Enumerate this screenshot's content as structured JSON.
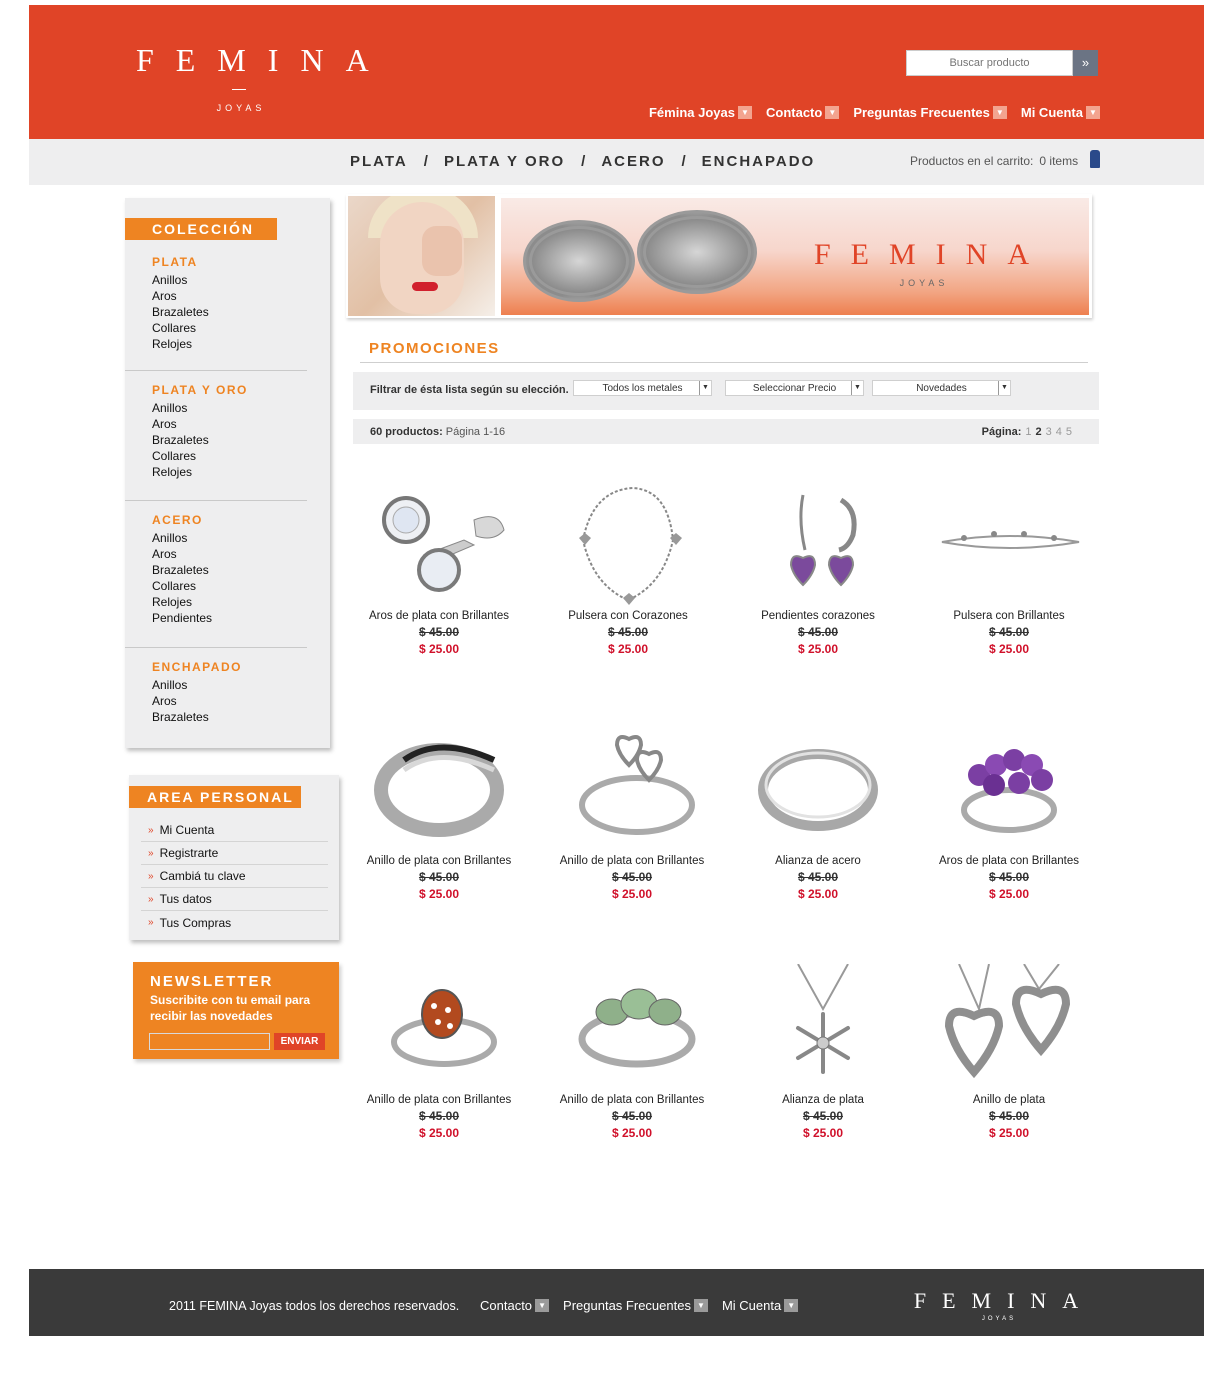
{
  "header": {
    "logo_main": "FEMINA",
    "logo_sub": "JOYAS",
    "search_placeholder": "Buscar producto",
    "search_icon": "»",
    "nav": [
      "Fémina Joyas",
      "Contacto",
      "Preguntas Frecuentes",
      "Mi Cuenta"
    ]
  },
  "catbar": {
    "categories": [
      "PLATA",
      "PLATA Y ORO",
      "ACERO",
      "ENCHAPADO"
    ],
    "separator": "/",
    "cart_label": "Productos  en el carrito:",
    "cart_count": "0 items"
  },
  "sidebar": {
    "coleccion_title": "COLECCIÓN",
    "groups": [
      {
        "title": "PLATA",
        "items": [
          "Anillos",
          "Aros",
          "Brazaletes",
          "Collares",
          "Relojes"
        ]
      },
      {
        "title": "PLATA Y ORO",
        "items": [
          "Anillos",
          "Aros",
          "Brazaletes",
          "Collares",
          "Relojes"
        ]
      },
      {
        "title": "ACERO",
        "items": [
          "Anillos",
          "Aros",
          "Brazaletes",
          "Collares",
          "Relojes",
          "Pendientes"
        ]
      },
      {
        "title": "ENCHAPADO",
        "items": [
          "Anillos",
          "Aros",
          "Brazaletes"
        ]
      }
    ],
    "personal_title": "AREA PERSONAL",
    "personal_items": [
      "Mi Cuenta",
      "Registrarte",
      "Cambiá tu clave",
      "Tus datos",
      "Tus Compras"
    ],
    "newsletter_title": "NEWSLETTER",
    "newsletter_text": "Suscribite con tu email para recibir las novedades",
    "newsletter_button": "ENVIAR"
  },
  "banner": {
    "logo_main": "FEMINA",
    "logo_sub": "JOYAS"
  },
  "content": {
    "section_title": "PROMOCIONES",
    "filter_label": "Filtrar de ésta lista según su elección.",
    "filters": [
      "Todos los metales",
      "Seleccionar Precio",
      "Novedades"
    ],
    "count_bold": "60 productos:",
    "count_page": "Página 1-16",
    "pages_label": "Página:",
    "pages": [
      "1",
      "2",
      "3",
      "4",
      "5"
    ],
    "current_page": "2"
  },
  "products": [
    {
      "name": "Aros de plata con Brillantes",
      "old_price": "$ 45.00",
      "new_price": "$ 25.00",
      "icon": "stud-earring-icon"
    },
    {
      "name": "Pulsera con Corazones",
      "old_price": "$ 45.00",
      "new_price": "$ 25.00",
      "icon": "bracelet-icon"
    },
    {
      "name": "Pendientes corazones",
      "old_price": "$ 45.00",
      "new_price": "$ 25.00",
      "icon": "heart-earrings-icon"
    },
    {
      "name": "Pulsera con Brillantes",
      "old_price": "$ 45.00",
      "new_price": "$ 25.00",
      "icon": "chain-bracelet-icon"
    },
    {
      "name": "Anillo de plata con Brillantes",
      "old_price": "$ 45.00",
      "new_price": "$ 25.00",
      "icon": "striped-ring-icon"
    },
    {
      "name": "Anillo de plata con Brillantes",
      "old_price": "$ 45.00",
      "new_price": "$ 25.00",
      "icon": "heart-ring-icon"
    },
    {
      "name": "Alianza de acero",
      "old_price": "$ 45.00",
      "new_price": "$ 25.00",
      "icon": "band-ring-icon"
    },
    {
      "name": "Aros de plata con Brillantes",
      "old_price": "$ 45.00",
      "new_price": "$ 25.00",
      "icon": "amethyst-ring-icon"
    },
    {
      "name": "Anillo de plata con Brillantes",
      "old_price": "$ 45.00",
      "new_price": "$ 25.00",
      "icon": "ladybug-ring-icon"
    },
    {
      "name": "Anillo de plata con Brillantes",
      "old_price": "$ 45.00",
      "new_price": "$ 25.00",
      "icon": "green-stone-ring-icon"
    },
    {
      "name": "Alianza de plata",
      "old_price": "$ 45.00",
      "new_price": "$ 25.00",
      "icon": "snowflake-pendant-icon"
    },
    {
      "name": "Anillo de plata",
      "old_price": "$ 45.00",
      "new_price": "$ 25.00",
      "icon": "double-heart-pendant-icon"
    }
  ],
  "footer": {
    "copyright": "2011 FEMINA Joyas todos los derechos reservados.",
    "links": [
      "Contacto",
      "Preguntas Frecuentes",
      "Mi Cuenta"
    ],
    "logo_main": "FEMINA",
    "logo_sub": "JOYAS"
  },
  "colors": {
    "brand_red": "#e04427",
    "brand_orange": "#ee8422",
    "price_red": "#d0102a",
    "footer": "#3a3a3a"
  }
}
